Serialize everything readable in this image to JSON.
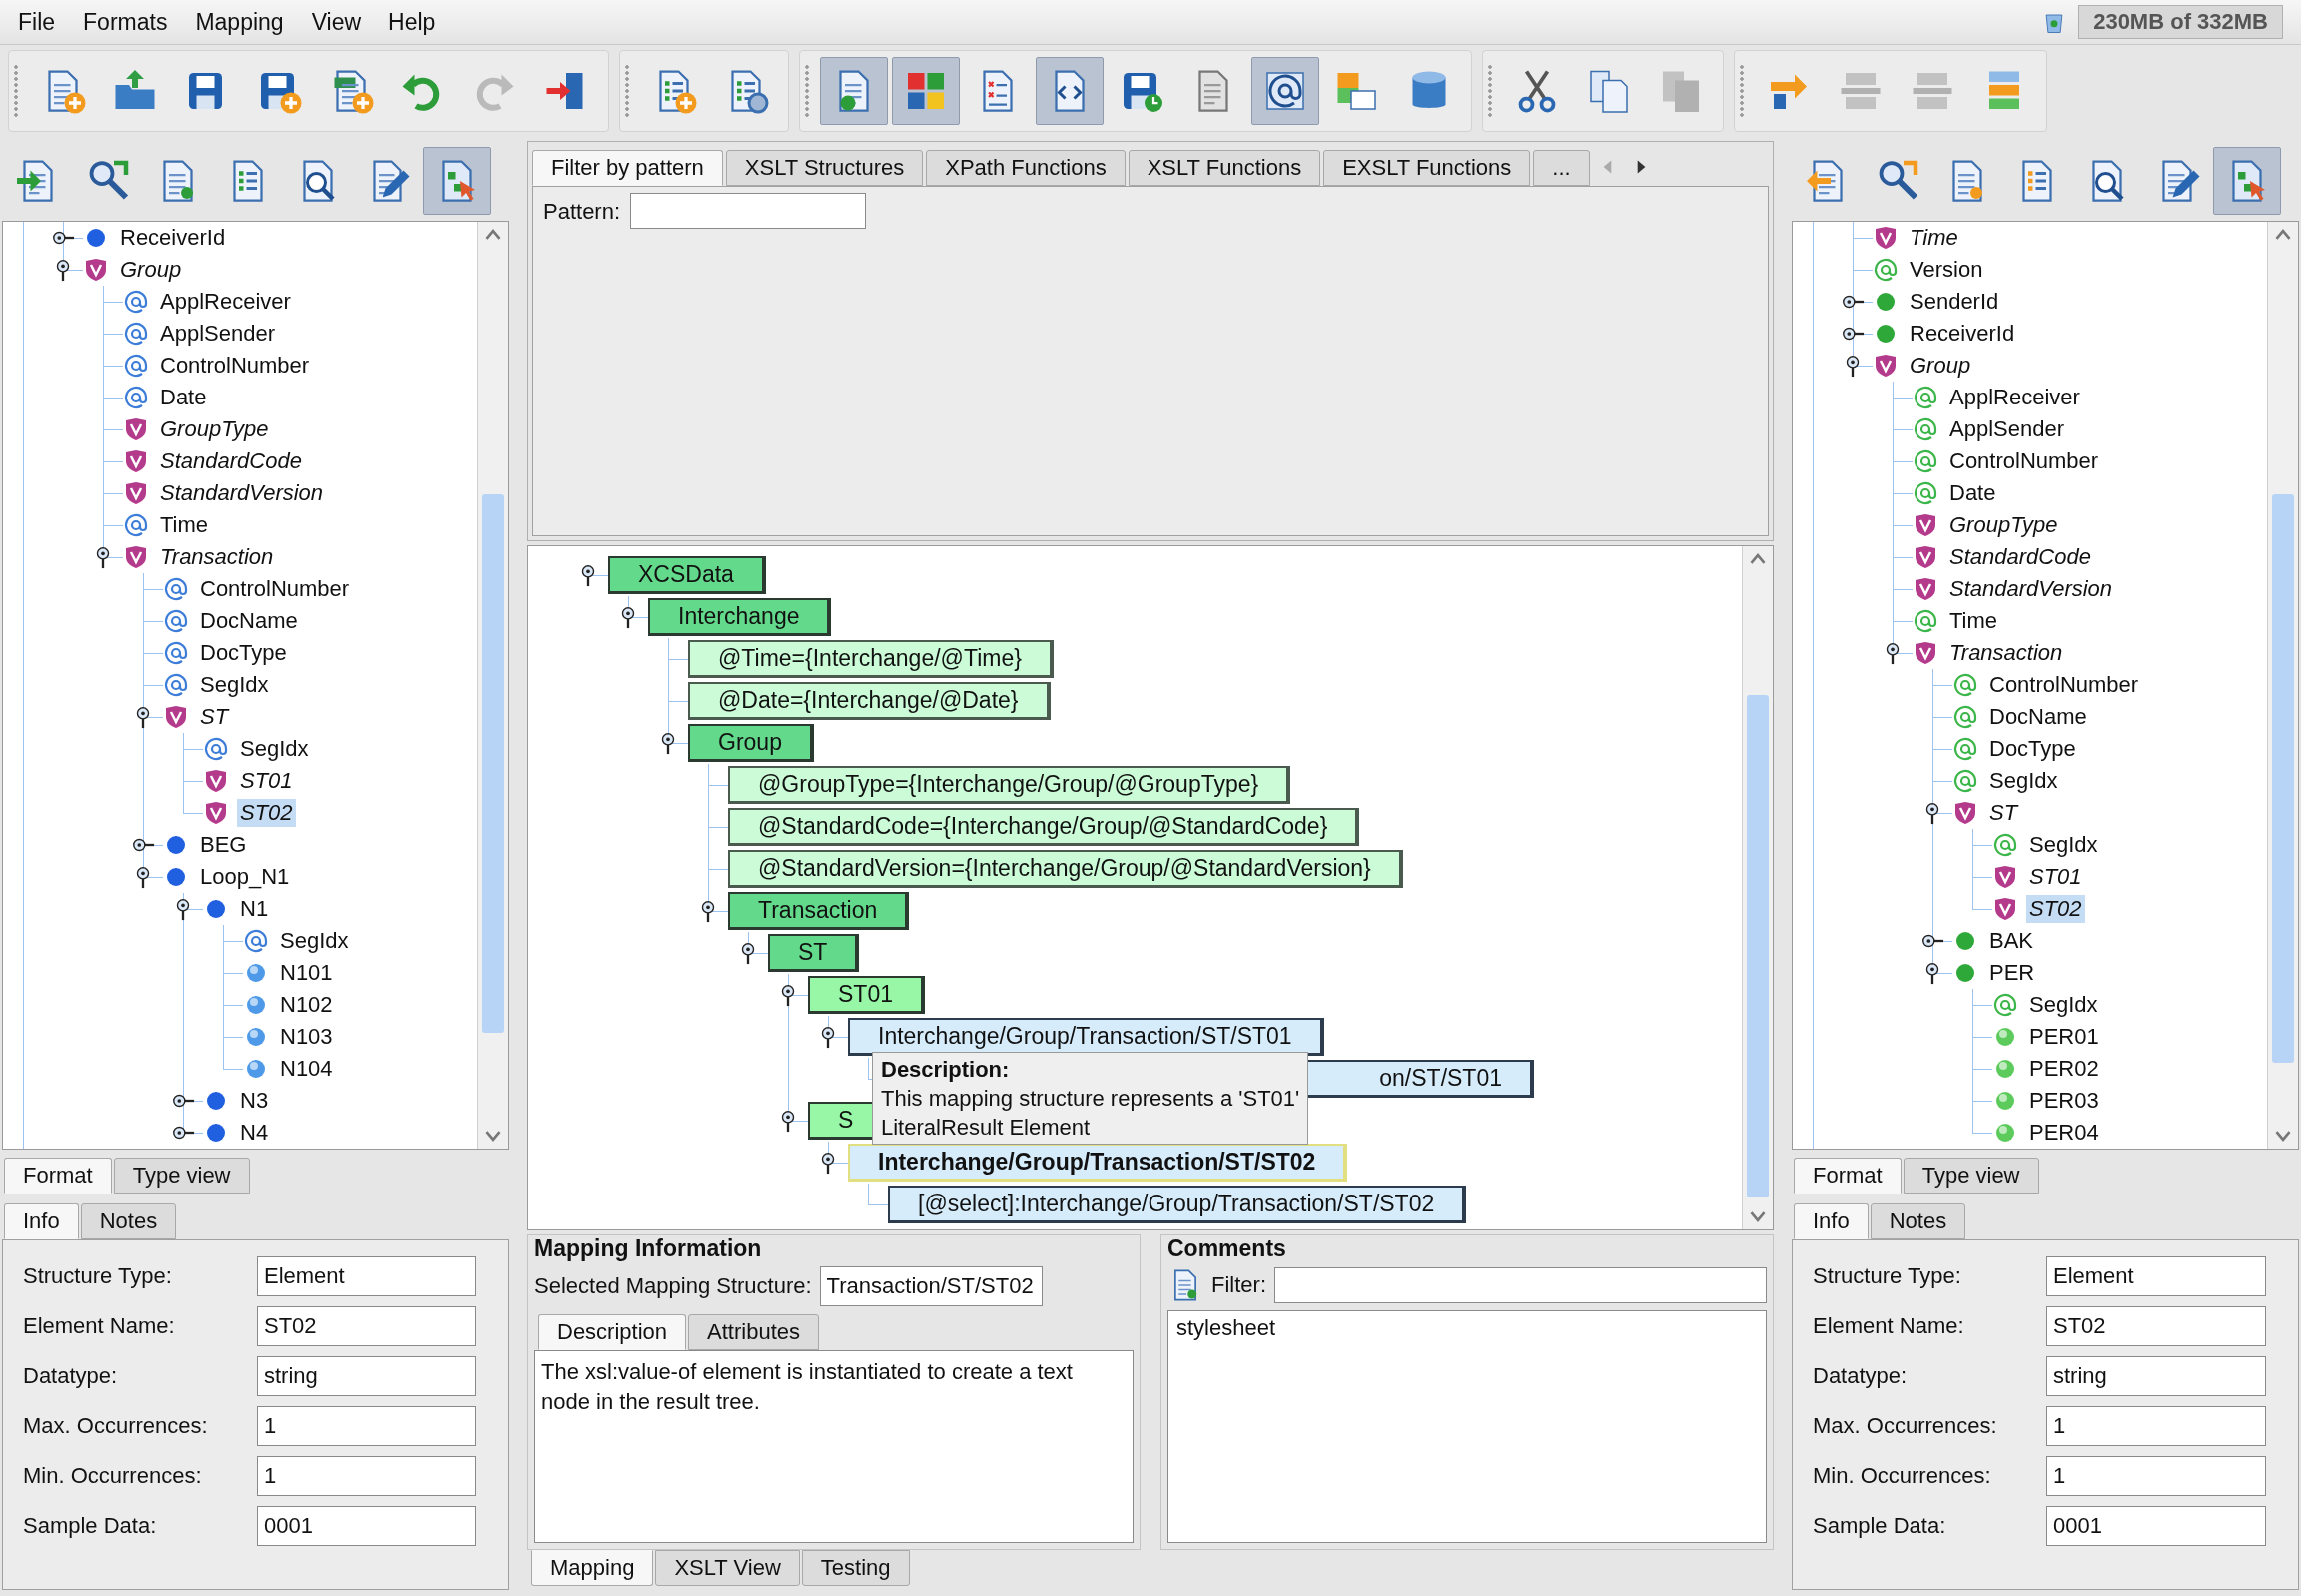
{
  "menu": [
    "File",
    "Formats",
    "Mapping",
    "View",
    "Help"
  ],
  "memory": "230MB of 332MB",
  "toolbar": [
    [
      {
        "pressed": false,
        "disabled": false
      },
      {
        "pressed": false,
        "disabled": false
      },
      {
        "pressed": false,
        "disabled": false
      },
      {
        "pressed": false,
        "disabled": false
      },
      {
        "pressed": false,
        "disabled": false
      },
      {
        "pressed": false,
        "disabled": false
      },
      {
        "pressed": false,
        "disabled": true
      },
      {
        "pressed": false,
        "disabled": false
      }
    ],
    [
      {
        "pressed": false,
        "disabled": false
      },
      {
        "pressed": false,
        "disabled": false
      }
    ],
    [
      {
        "pressed": true,
        "disabled": false
      },
      {
        "pressed": true,
        "disabled": false
      },
      {
        "pressed": false,
        "disabled": false
      },
      {
        "pressed": true,
        "disabled": false
      },
      {
        "pressed": false,
        "disabled": false
      },
      {
        "pressed": false,
        "disabled": false
      },
      {
        "pressed": true,
        "disabled": false
      },
      {
        "pressed": false,
        "disabled": false
      },
      {
        "pressed": false,
        "disabled": false
      }
    ],
    [
      {
        "pressed": false,
        "disabled": false
      },
      {
        "pressed": false,
        "disabled": false
      },
      {
        "pressed": false,
        "disabled": true
      }
    ],
    [
      {
        "pressed": false,
        "disabled": false
      },
      {
        "pressed": false,
        "disabled": true
      },
      {
        "pressed": false,
        "disabled": true
      },
      {
        "pressed": false,
        "disabled": false
      }
    ]
  ],
  "left_panel": {
    "toolbar": [
      {
        "pressed": false
      },
      {
        "pressed": false
      },
      {
        "pressed": false
      },
      {
        "pressed": false
      },
      {
        "pressed": false
      },
      {
        "pressed": false
      },
      {
        "pressed": true
      }
    ],
    "tree": [
      {
        "label": "ReceiverId",
        "kind": "segment",
        "expanded": false,
        "selected": false
      },
      {
        "label": "Group",
        "kind": "structure",
        "expanded": true,
        "selected": false,
        "children": [
          {
            "label": "ApplReceiver",
            "kind": "attribute",
            "selected": false
          },
          {
            "label": "ApplSender",
            "kind": "attribute",
            "selected": false
          },
          {
            "label": "ControlNumber",
            "kind": "attribute",
            "selected": false
          },
          {
            "label": "Date",
            "kind": "attribute",
            "selected": false
          },
          {
            "label": "GroupType",
            "kind": "structure",
            "selected": false
          },
          {
            "label": "StandardCode",
            "kind": "structure",
            "selected": false
          },
          {
            "label": "StandardVersion",
            "kind": "structure",
            "selected": false
          },
          {
            "label": "Time",
            "kind": "attribute",
            "selected": false
          },
          {
            "label": "Transaction",
            "kind": "structure",
            "expanded": true,
            "selected": false,
            "children": [
              {
                "label": "ControlNumber",
                "kind": "attribute",
                "selected": false
              },
              {
                "label": "DocName",
                "kind": "attribute",
                "selected": false
              },
              {
                "label": "DocType",
                "kind": "attribute",
                "selected": false
              },
              {
                "label": "SegIdx",
                "kind": "attribute",
                "selected": false
              },
              {
                "label": "ST",
                "kind": "structure",
                "expanded": true,
                "selected": false,
                "children": [
                  {
                    "label": "SegIdx",
                    "kind": "attribute",
                    "selected": false
                  },
                  {
                    "label": "ST01",
                    "kind": "structure",
                    "selected": false
                  },
                  {
                    "label": "ST02",
                    "kind": "structure",
                    "selected": true
                  }
                ]
              },
              {
                "label": "BEG",
                "kind": "segment",
                "expanded": false,
                "selected": false
              },
              {
                "label": "Loop_N1",
                "kind": "segment",
                "expanded": true,
                "selected": false,
                "children": [
                  {
                    "label": "N1",
                    "kind": "segment",
                    "expanded": true,
                    "selected": false,
                    "children": [
                      {
                        "label": "SegIdx",
                        "kind": "attribute",
                        "selected": false
                      },
                      {
                        "label": "N101",
                        "kind": "field",
                        "selected": false
                      },
                      {
                        "label": "N102",
                        "kind": "field",
                        "selected": false
                      },
                      {
                        "label": "N103",
                        "kind": "field",
                        "selected": false
                      },
                      {
                        "label": "N104",
                        "kind": "field",
                        "selected": false
                      }
                    ]
                  },
                  {
                    "label": "N3",
                    "kind": "segment",
                    "expanded": false,
                    "selected": false
                  },
                  {
                    "label": "N4",
                    "kind": "segment",
                    "expanded": false,
                    "selected": false
                  }
                ]
              }
            ]
          }
        ]
      }
    ],
    "view_tabs": [
      {
        "label": "Format",
        "selected": true
      },
      {
        "label": "Type view",
        "selected": false
      }
    ],
    "info_tabs": [
      {
        "label": "Info",
        "selected": true
      },
      {
        "label": "Notes",
        "selected": false
      }
    ],
    "fields": [
      {
        "label": "Structure Type:",
        "value": "Element"
      },
      {
        "label": "Element Name:",
        "value": "ST02"
      },
      {
        "label": "Datatype:",
        "value": "string"
      },
      {
        "label": "Max. Occurrences:",
        "value": "1"
      },
      {
        "label": "Min. Occurrences:",
        "value": "1"
      },
      {
        "label": "Sample Data:",
        "value": "0001"
      }
    ]
  },
  "center": {
    "palette_tabs": [
      {
        "label": "Filter by pattern",
        "selected": true
      },
      {
        "label": "XSLT Structures",
        "selected": false
      },
      {
        "label": "XPath Functions",
        "selected": false
      },
      {
        "label": "XSLT Functions",
        "selected": false
      },
      {
        "label": "EXSLT Functions",
        "selected": false
      },
      {
        "label": "...",
        "selected": false
      }
    ],
    "pattern_label": "Pattern:",
    "mapping_tree": [
      {
        "label": "XCSData",
        "kind": "element",
        "expanded": true,
        "selected": false,
        "children": [
          {
            "label": "Interchange",
            "kind": "element",
            "expanded": true,
            "selected": false,
            "children": [
              {
                "label": "@Time={Interchange/@Time}",
                "kind": "attribute",
                "selected": false
              },
              {
                "label": "@Date={Interchange/@Date}",
                "kind": "attribute",
                "selected": false
              },
              {
                "label": "Group",
                "kind": "element",
                "expanded": true,
                "selected": false,
                "children": [
                  {
                    "label": "@GroupType={Interchange/Group/@GroupType}",
                    "kind": "attribute",
                    "selected": false
                  },
                  {
                    "label": "@StandardCode={Interchange/Group/@StandardCode}",
                    "kind": "attribute",
                    "selected": false
                  },
                  {
                    "label": "@StandardVersion={Interchange/Group/@StandardVersion}",
                    "kind": "attribute",
                    "selected": false
                  },
                  {
                    "label": "Transaction",
                    "kind": "element",
                    "expanded": true,
                    "selected": false,
                    "children": [
                      {
                        "label": "ST",
                        "kind": "element",
                        "expanded": true,
                        "selected": false,
                        "children": [
                          {
                            "label": "ST01",
                            "kind": "literal",
                            "expanded": true,
                            "selected": false,
                            "children": [
                              {
                                "label": "Interchange/Group/Transaction/ST/ST01",
                                "kind": "value",
                                "expanded": true,
                                "selected": false,
                                "children": [
                                  {
                                    "label": "on/ST/ST01",
                                    "kind": "select",
                                    "covered": true,
                                    "selected": false
                                  }
                                ]
                              }
                            ]
                          },
                          {
                            "label": "S",
                            "kind": "literal",
                            "expanded": true,
                            "selected": false,
                            "children": [
                              {
                                "label": "Interchange/Group/Transaction/ST/ST02",
                                "kind": "value",
                                "expanded": true,
                                "selected": true,
                                "children": [
                                  {
                                    "label": "[@select]:Interchange/Group/Transaction/ST/ST02",
                                    "kind": "select",
                                    "selected": false
                                  }
                                ]
                              }
                            ]
                          }
                        ]
                      }
                    ]
                  }
                ]
              }
            ]
          }
        ]
      }
    ],
    "tooltip": {
      "title": "Description:",
      "lines": [
        "This mapping structure represents a 'ST01'",
        "LiteralResult Element"
      ]
    },
    "mapping_info": {
      "title": "Mapping Information",
      "selected_label": "Selected Mapping Structure:",
      "selected_value": "Transaction/ST/ST02",
      "tabs": [
        {
          "label": "Description",
          "selected": true
        },
        {
          "label": "Attributes",
          "selected": false
        }
      ],
      "description": "The xsl:value-of element is instantiated to create a text node in the result tree."
    },
    "comments": {
      "title": "Comments",
      "filter_label": "Filter:",
      "items": [
        "stylesheet"
      ]
    },
    "bottom_tabs": [
      {
        "label": "Mapping",
        "selected": true
      },
      {
        "label": "XSLT View",
        "selected": false
      },
      {
        "label": "Testing",
        "selected": false
      }
    ]
  },
  "right_panel": {
    "toolbar": [
      {
        "pressed": false
      },
      {
        "pressed": false
      },
      {
        "pressed": false
      },
      {
        "pressed": false
      },
      {
        "pressed": false
      },
      {
        "pressed": false
      },
      {
        "pressed": true
      }
    ],
    "tree": [
      {
        "label": "Time",
        "kind": "structure",
        "selected": false
      },
      {
        "label": "Version",
        "kind": "attribute",
        "selected": false
      },
      {
        "label": "SenderId",
        "kind": "segment",
        "expanded": false,
        "selected": false
      },
      {
        "label": "ReceiverId",
        "kind": "segment",
        "expanded": false,
        "selected": false
      },
      {
        "label": "Group",
        "kind": "structure",
        "expanded": true,
        "selected": false,
        "children": [
          {
            "label": "ApplReceiver",
            "kind": "attribute",
            "selected": false
          },
          {
            "label": "ApplSender",
            "kind": "attribute",
            "selected": false
          },
          {
            "label": "ControlNumber",
            "kind": "attribute",
            "selected": false
          },
          {
            "label": "Date",
            "kind": "attribute",
            "selected": false
          },
          {
            "label": "GroupType",
            "kind": "structure",
            "selected": false
          },
          {
            "label": "StandardCode",
            "kind": "structure",
            "selected": false
          },
          {
            "label": "StandardVersion",
            "kind": "structure",
            "selected": false
          },
          {
            "label": "Time",
            "kind": "attribute",
            "selected": false
          },
          {
            "label": "Transaction",
            "kind": "structure",
            "expanded": true,
            "selected": false,
            "children": [
              {
                "label": "ControlNumber",
                "kind": "attribute",
                "selected": false
              },
              {
                "label": "DocName",
                "kind": "attribute",
                "selected": false
              },
              {
                "label": "DocType",
                "kind": "attribute",
                "selected": false
              },
              {
                "label": "SegIdx",
                "kind": "attribute",
                "selected": false
              },
              {
                "label": "ST",
                "kind": "structure",
                "expanded": true,
                "selected": false,
                "children": [
                  {
                    "label": "SegIdx",
                    "kind": "attribute",
                    "selected": false
                  },
                  {
                    "label": "ST01",
                    "kind": "structure",
                    "selected": false
                  },
                  {
                    "label": "ST02",
                    "kind": "structure",
                    "selected": true
                  }
                ]
              },
              {
                "label": "BAK",
                "kind": "segment",
                "expanded": false,
                "selected": false
              },
              {
                "label": "PER",
                "kind": "segment",
                "expanded": true,
                "selected": false,
                "children": [
                  {
                    "label": "SegIdx",
                    "kind": "attribute",
                    "selected": false
                  },
                  {
                    "label": "PER01",
                    "kind": "field",
                    "selected": false
                  },
                  {
                    "label": "PER02",
                    "kind": "field",
                    "selected": false
                  },
                  {
                    "label": "PER03",
                    "kind": "field",
                    "selected": false
                  },
                  {
                    "label": "PER04",
                    "kind": "field",
                    "selected": false
                  }
                ]
              }
            ]
          }
        ]
      }
    ],
    "view_tabs": [
      {
        "label": "Format",
        "selected": true
      },
      {
        "label": "Type view",
        "selected": false
      }
    ],
    "info_tabs": [
      {
        "label": "Info",
        "selected": true
      },
      {
        "label": "Notes",
        "selected": false
      }
    ],
    "fields": [
      {
        "label": "Structure Type:",
        "value": "Element"
      },
      {
        "label": "Element Name:",
        "value": "ST02"
      },
      {
        "label": "Datatype:",
        "value": "string"
      },
      {
        "label": "Max. Occurrences:",
        "value": "1"
      },
      {
        "label": "Min. Occurrences:",
        "value": "1"
      },
      {
        "label": "Sample Data:",
        "value": "0001"
      }
    ]
  }
}
